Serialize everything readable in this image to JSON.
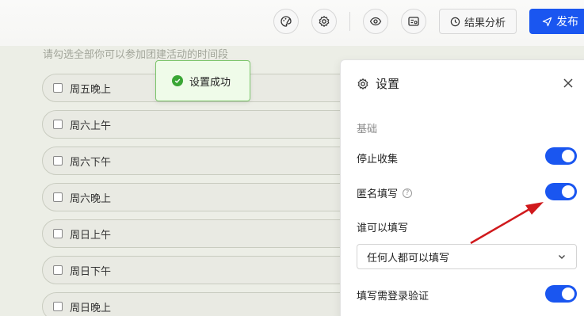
{
  "toolbar": {
    "icons": [
      "palette-icon",
      "gear-icon",
      "eye-icon",
      "preview-icon"
    ],
    "analysis_label": "结果分析",
    "publish_label": "发布"
  },
  "form": {
    "hint": "请勾选全部你可以参加团建活动的时间段",
    "options": [
      "周五晚上",
      "周六上午",
      "周六下午",
      "周六晚上",
      "周日上午",
      "周日下午",
      "周日晚上"
    ]
  },
  "toast": {
    "message": "设置成功"
  },
  "settings": {
    "title": "设置",
    "section": "基础",
    "stop_collect": "停止收集",
    "anonymous": "匿名填写",
    "who_can_fill": "谁可以填写",
    "who_value": "任何人都可以填写",
    "login_verify": "填写需登录验证"
  },
  "colors": {
    "accent": "#1a56f0",
    "success": "#3aa635",
    "arrow": "#d0191c"
  }
}
